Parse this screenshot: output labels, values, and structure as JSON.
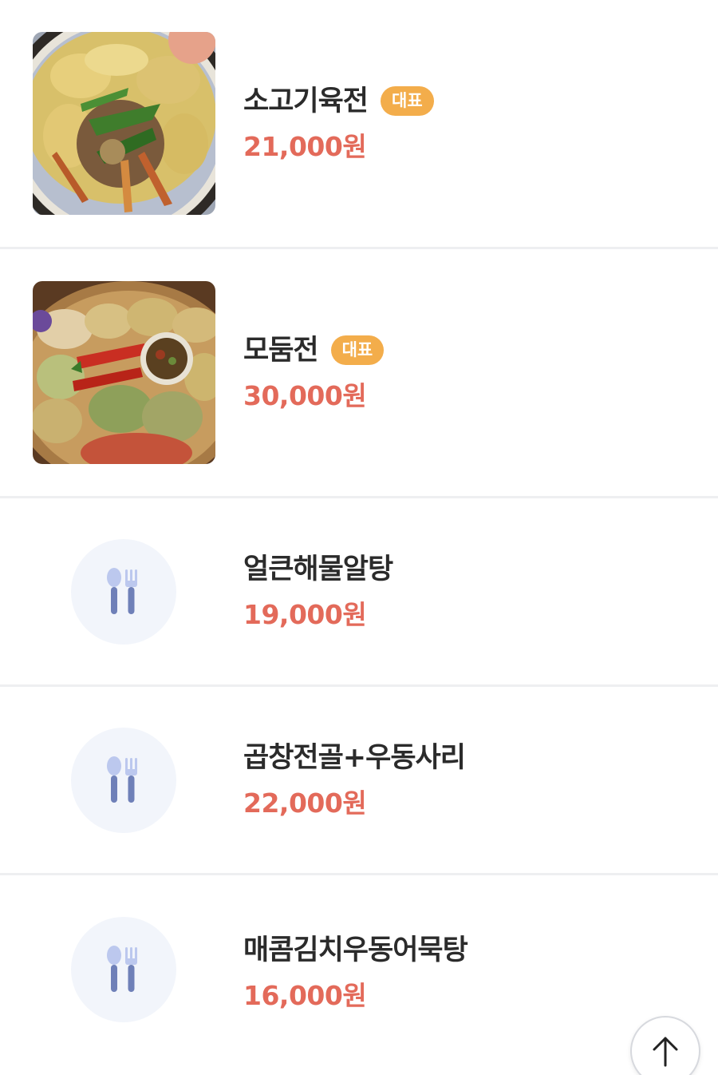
{
  "menu": {
    "items": [
      {
        "name": "소고기육전",
        "badge": "대표",
        "price": "21,000원",
        "image": "photo-meat-pancake"
      },
      {
        "name": "모둠전",
        "badge": "대표",
        "price": "30,000원",
        "image": "photo-assorted-pancakes"
      },
      {
        "name": "얼큰해물알탕",
        "price": "19,000원",
        "image": "utensils-icon"
      },
      {
        "name": "곱창전골+우동사리",
        "price": "22,000원",
        "image": "utensils-icon"
      },
      {
        "name": "매콤김치우동어묵탕",
        "price": "16,000원",
        "image": "utensils-icon"
      }
    ]
  },
  "colors": {
    "price": "#e36a5a",
    "badge": "#f3ad4b",
    "placeholder_bg": "#f2f5fb",
    "divider": "#eeeff1"
  },
  "scroll_top": {
    "icon": "arrow-up-icon"
  }
}
